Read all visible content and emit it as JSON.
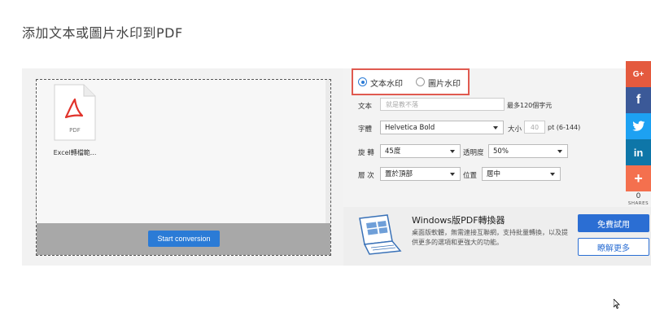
{
  "page": {
    "title": "添加文本或圖片水印到PDF"
  },
  "file": {
    "name": "Excel轉檔範...",
    "icon_text": "PDF"
  },
  "actions": {
    "start_label": "Start conversion"
  },
  "mode": {
    "text_label": "文本水印",
    "image_label": "圖片水印",
    "selected": "text"
  },
  "form": {
    "text_label": "文本",
    "text_placeholder": "就是教不落",
    "text_hint": "最多120個字元",
    "font_label": "字體",
    "font_value": "Helvetica Bold",
    "size_label": "大小",
    "size_placeholder": "40",
    "size_unit": "pt (6-144)",
    "rotate_label": "旋 轉",
    "rotate_value": "45度",
    "opacity_label": "透明度",
    "opacity_value": "50%",
    "layer_label": "層 次",
    "layer_value": "置於頂部",
    "position_label": "位置",
    "position_value": "居中"
  },
  "promo": {
    "title": "Windows版PDF轉換器",
    "desc": "桌面版軟體，無需連接互聯網，支持批量轉換，以及提供更多的選項和更強大的功能。",
    "trial_label": "免費試用",
    "more_label": "瞭解更多"
  },
  "share": {
    "count": "0",
    "label": "SHARES",
    "buttons": [
      {
        "icon": "google-plus-icon",
        "glyph": "G+",
        "color": "#e45a3e"
      },
      {
        "icon": "facebook-icon",
        "glyph": "f",
        "color": "#3b5998"
      },
      {
        "icon": "twitter-icon",
        "glyph": "🐦",
        "color": "#1da1f2"
      },
      {
        "icon": "linkedin-icon",
        "glyph": "in",
        "color": "#0e76a8"
      },
      {
        "icon": "more-share-icon",
        "glyph": "+",
        "color": "#f4704e"
      }
    ]
  },
  "colors": {
    "accent": "#2b7bd6",
    "highlight": "#e05a50",
    "pdf_red": "#e1332b"
  }
}
